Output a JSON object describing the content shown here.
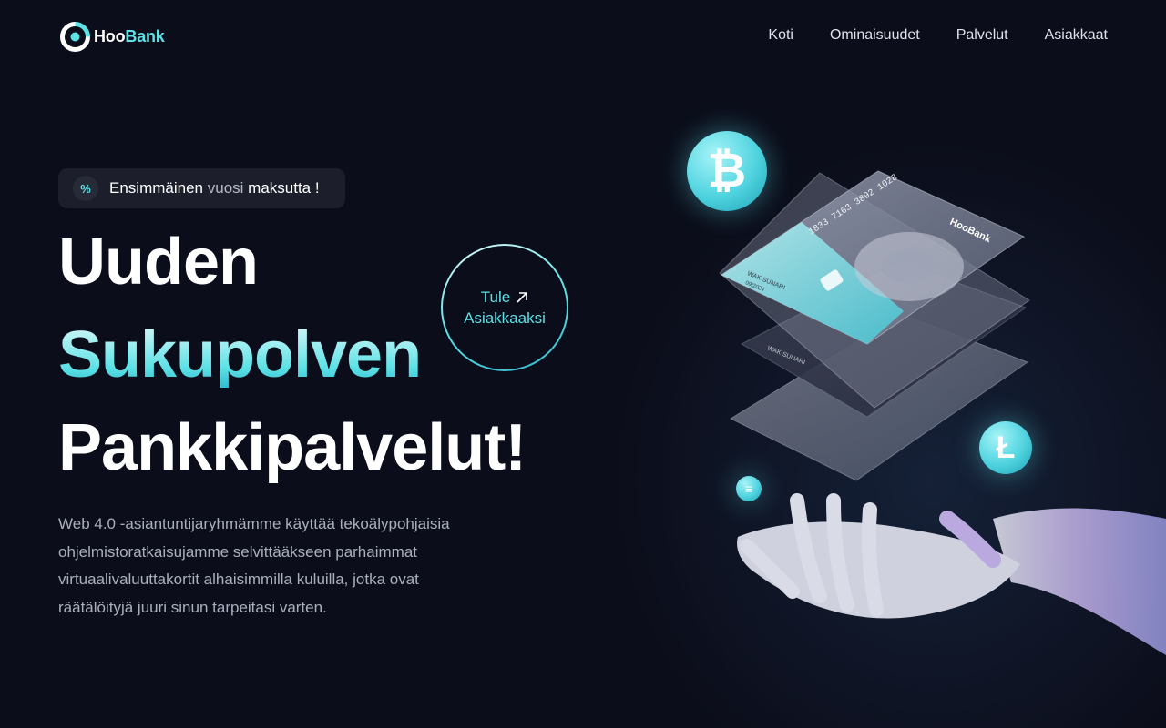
{
  "brand": {
    "name_part1": "Hoo",
    "name_part2": "Bank"
  },
  "nav": {
    "items": [
      "Koti",
      "Ominaisuudet",
      "Palvelut",
      "Asiakkaat"
    ]
  },
  "badge": {
    "icon": "percent-icon",
    "text_part1": "Ensimmäinen",
    "text_part2": "vuosi",
    "text_part3": "maksutta !"
  },
  "hero": {
    "line1": "Uuden",
    "line2": "Sukupolven",
    "line3": "Pankkipalvelut!",
    "description": "Web 4.0 -asiantuntijaryhmämme käyttää tekoälypohjaisia ohjelmistoratkaisujamme selvittääkseen parhaimmat virtuaalivaluuttakortit alhaisimmilla kuluilla, jotka ovat räätälöityjä juuri sinun tarpeitasi varten."
  },
  "cta": {
    "line1": "Tule",
    "line2": "Asiakkaaksi",
    "icon": "arrow-up-right-icon"
  },
  "illustration": {
    "card_number": "1833 7163 3892 1028",
    "card_holder": "WAK SUNARI",
    "card_expiry": "09/2024",
    "card_brand": "HooBank"
  },
  "colors": {
    "accent": "#5ce1e6",
    "background": "#0b0d1a",
    "badge_bg": "#1c1f2b",
    "text_muted": "#a9afbd"
  }
}
